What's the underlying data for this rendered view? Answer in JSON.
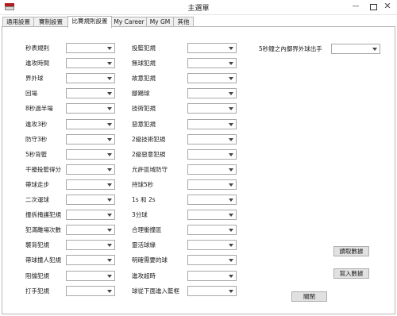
{
  "window": {
    "title": "主選單",
    "min_glyph": "—",
    "close_glyph": "✕",
    "icon": "app-window-icon"
  },
  "tabs": [
    "通用設置",
    "賽制設置",
    "比賽規則設置",
    "My Career",
    "My GM",
    "其他"
  ],
  "active_tab": 2,
  "rules": {
    "col1": [
      "秒表規則",
      "進攻時間",
      "界外球",
      "回場",
      "8秒過半場",
      "進攻3秒",
      "防守3秒",
      "5秒背籃",
      "干擾投籃得分",
      "帶球走步",
      "二次運球",
      "撞拆掩護犯規",
      "犯滿離場次數",
      "襲背犯規",
      "帶球撞人犯規",
      "阻擋犯規",
      "打手犯規"
    ],
    "col2": [
      "投籃犯規",
      "無球犯規",
      "故意犯規",
      "腳踢球",
      "技術犯規",
      "惡意犯規",
      "2級技術犯規",
      "2級惡意犯規",
      "允許區域防守",
      "持球5秒",
      "1s 和 2s",
      "3分球",
      "合理衝撞區",
      "靈活球緣",
      "明確需要的球",
      "進攻超時",
      "球從下面進入籃框"
    ],
    "col3": [
      "5秒鐘之內擲界外球出手"
    ]
  },
  "buttons": {
    "read": "讀取數據",
    "write": "寫入數據",
    "close": "關閉"
  }
}
